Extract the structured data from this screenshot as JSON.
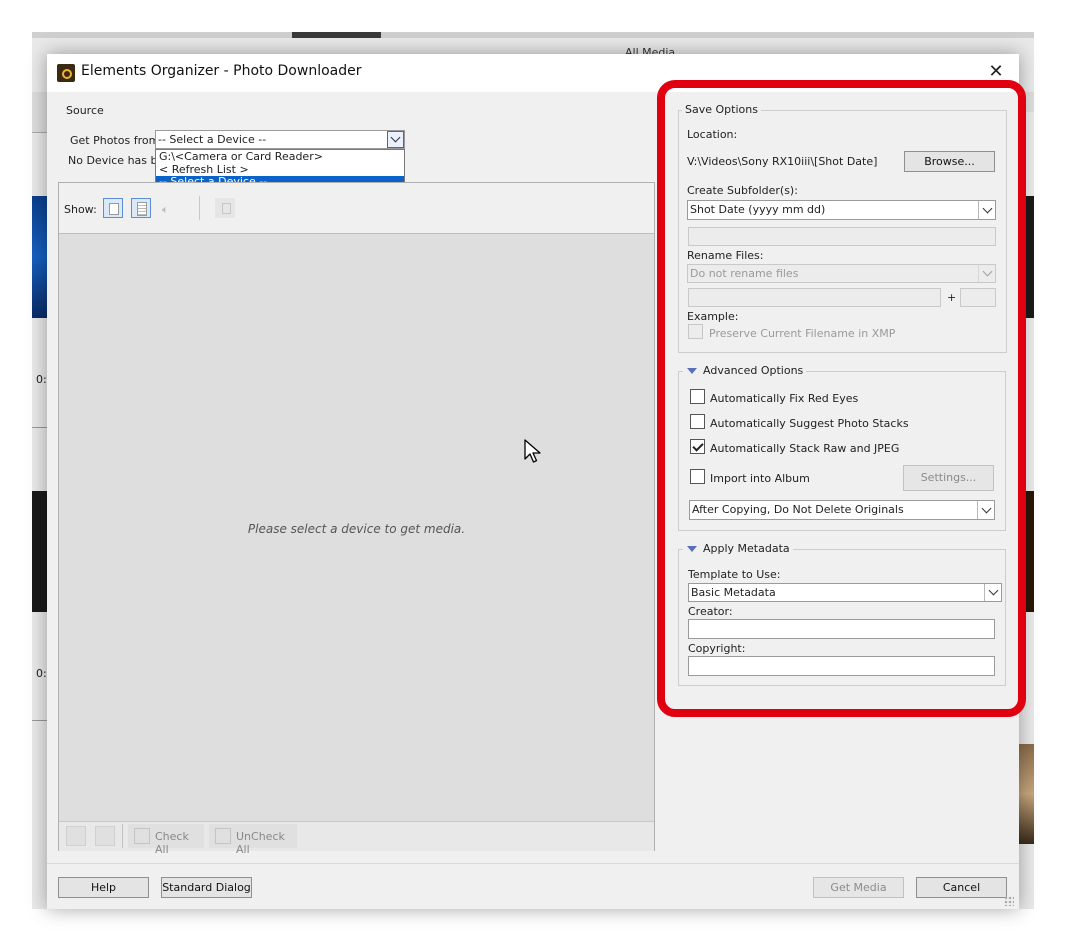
{
  "window": {
    "title": "Elements Organizer - Photo Downloader",
    "close_glyph": "✕",
    "background_fragment": "All Media"
  },
  "background_left": {
    "time_top": "0:",
    "time_bottom": "0:"
  },
  "source": {
    "legend": "Source",
    "get_photos_label": "Get Photos from:",
    "selected_value": "-- Select a Device --",
    "status_text": "No Device has bee",
    "dropdown_options": [
      "G:\\<Camera or Card Reader>",
      "< Refresh List >",
      "-- Select a Device --"
    ],
    "show_label": "Show:",
    "placeholder": "Please select a device to get media."
  },
  "bottom_toolbar": {
    "check_all": "Check All",
    "uncheck_all": "UnCheck All"
  },
  "save_options": {
    "legend": "Save Options",
    "location_label": "Location:",
    "location_value": "V:\\Videos\\Sony RX10iii\\[Shot Date]",
    "browse_label": "Browse...",
    "subfolder_label": "Create Subfolder(s):",
    "subfolder_value": "Shot Date (yyyy mm dd)",
    "rename_label": "Rename Files:",
    "rename_value": "Do not rename files",
    "plus": "+",
    "example_label": "Example:",
    "preserve_label": "Preserve Current Filename in XMP"
  },
  "advanced_options": {
    "legend": "Advanced Options",
    "checkboxes": [
      {
        "label": "Automatically Fix Red Eyes",
        "checked": false
      },
      {
        "label": "Automatically Suggest Photo Stacks",
        "checked": false
      },
      {
        "label": "Automatically Stack Raw and JPEG",
        "checked": true
      },
      {
        "label": "Import into Album",
        "checked": false
      }
    ],
    "settings_label": "Settings...",
    "after_copy_value": "After Copying, Do Not Delete Originals"
  },
  "apply_metadata": {
    "legend": "Apply Metadata",
    "template_label": "Template to Use:",
    "template_value": "Basic Metadata",
    "creator_label": "Creator:",
    "creator_value": "",
    "copyright_label": "Copyright:",
    "copyright_value": ""
  },
  "footer": {
    "help": "Help",
    "standard_dialog": "Standard Dialog",
    "get_media": "Get Media",
    "cancel": "Cancel"
  },
  "colors": {
    "highlight_box": "#e00010",
    "selection": "#0a63c9",
    "dialog_bg": "#f0f0f0"
  }
}
